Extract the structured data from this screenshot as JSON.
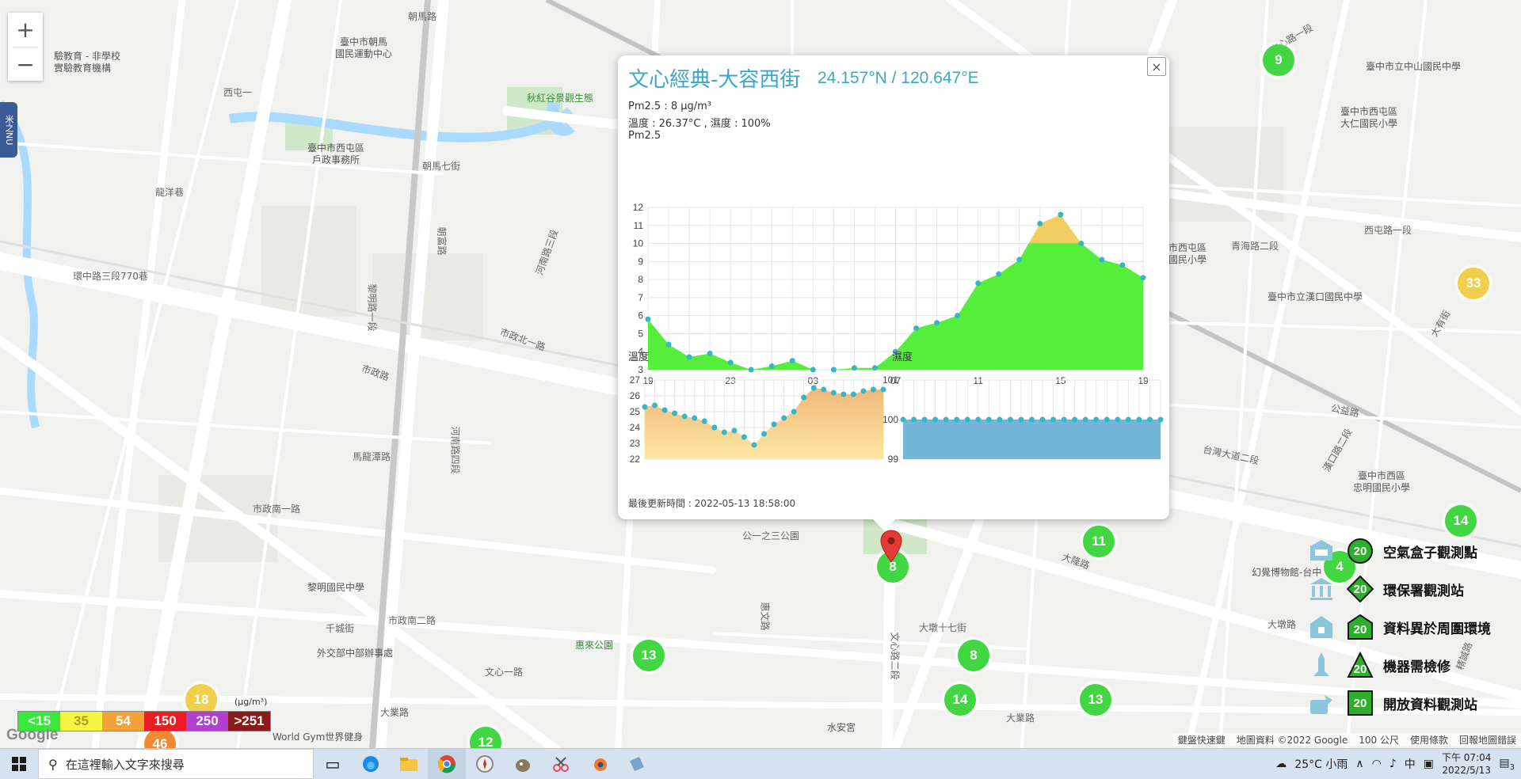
{
  "map": {
    "zoom_in": "+",
    "zoom_out": "−",
    "side_tab": "米之NU",
    "road_labels": [
      {
        "text": "朝馬路"
      },
      {
        "text": "西屯一"
      },
      {
        "text": "龍洋巷"
      },
      {
        "text": "環中路三段770巷"
      },
      {
        "text": "黎明路一段"
      },
      {
        "text": "市政路"
      },
      {
        "text": "市政北一路"
      },
      {
        "text": "河南路四段"
      },
      {
        "text": "馬龍潭路"
      },
      {
        "text": "市政南一路"
      },
      {
        "text": "市政南二路"
      },
      {
        "text": "千城街"
      },
      {
        "text": "文心一路"
      },
      {
        "text": "大業路"
      },
      {
        "text": "惠文路"
      },
      {
        "text": "大墩十七街"
      },
      {
        "text": "台灣大道二段"
      },
      {
        "text": "文心路二段"
      },
      {
        "text": "公益路"
      },
      {
        "text": "大隆路"
      },
      {
        "text": "西屯路一段"
      },
      {
        "text": "漢口路二段"
      },
      {
        "text": "青海路二段"
      },
      {
        "text": "大有街"
      },
      {
        "text": "文心路一段"
      },
      {
        "text": "大墩路"
      },
      {
        "text": "精誠路"
      },
      {
        "text": "朝馬七街"
      },
      {
        "text": "朝富路"
      },
      {
        "text": "河南路三段"
      },
      {
        "text": "公一之三公園"
      },
      {
        "text": "大業路"
      }
    ],
    "pois": [
      {
        "text": "臺中市朝馬\n國民運動中心",
        "kind": "poi"
      },
      {
        "text": "秋紅谷景觀生態",
        "kind": "park"
      },
      {
        "text": "臺中市西屯區\n戶政事務所",
        "kind": "poi"
      },
      {
        "text": "臺中市立中山國民中學",
        "kind": "poi"
      },
      {
        "text": "臺中市西屯區\n大仁國民小學",
        "kind": "poi"
      },
      {
        "text": "臺中市立漢口國民中學",
        "kind": "poi"
      },
      {
        "text": "市西屯區\n國民小學",
        "kind": "poi"
      },
      {
        "text": "臺中市西區\n忠明國民小學",
        "kind": "poi"
      },
      {
        "text": "幻覺博物館-台中",
        "kind": "poi"
      },
      {
        "text": "黎明國民中學",
        "kind": "poi"
      },
      {
        "text": "惠來公園",
        "kind": "park"
      },
      {
        "text": "外交部中部辦事處",
        "kind": "poi"
      },
      {
        "text": "World Gym世界健身",
        "kind": "poi"
      },
      {
        "text": "水安宮",
        "kind": "poi"
      },
      {
        "text": "驗教育 - 非學校\n實驗教育機構",
        "kind": "poi"
      }
    ],
    "clusters": [
      {
        "value": "9",
        "color": "green"
      },
      {
        "value": "33",
        "color": "yellow"
      },
      {
        "value": "14",
        "color": "green"
      },
      {
        "value": "11",
        "color": "green"
      },
      {
        "value": "4",
        "color": "green"
      },
      {
        "value": "8",
        "color": "green"
      },
      {
        "value": "13",
        "color": "green"
      },
      {
        "value": "8",
        "color": "green"
      },
      {
        "value": "14",
        "color": "green"
      },
      {
        "value": "13",
        "color": "green"
      },
      {
        "value": "18",
        "color": "yellow"
      },
      {
        "value": "46",
        "color": "orange"
      },
      {
        "value": "12",
        "color": "green"
      }
    ],
    "google_logo": "Google",
    "attribution": [
      "鍵盤快速鍵",
      "地圖資料 ©2022 Google",
      "100 公尺",
      "使用條款",
      "回報地圖錯誤"
    ]
  },
  "popup": {
    "close": "×",
    "title": "文心經典-大容西街",
    "coord": "24.157°N / 120.647°E",
    "pm_line": "Pm2.5 : 8 μg/m³",
    "temp_line": "溫度 : 26.37°C , 濕度 : 100%",
    "chart_pm_title": "Pm2.5",
    "chart_temp_title": "溫度",
    "chart_hum_title": "濕度",
    "updated": "最後更新時間 : 2022-05-13 18:58:00"
  },
  "chart_data": [
    {
      "type": "area",
      "title": "Pm2.5",
      "x_ticks": [
        "19",
        "23",
        "03",
        "07",
        "11",
        "15",
        "19"
      ],
      "ylim": [
        3,
        12
      ],
      "y_ticks": [
        3,
        4,
        5,
        6,
        7,
        8,
        9,
        10,
        11,
        12
      ],
      "values": [
        5.8,
        4.4,
        3.7,
        3.9,
        3.4,
        3.0,
        3.2,
        3.5,
        3.0,
        3.0,
        3.1,
        3.1,
        4.0,
        5.3,
        5.6,
        6.0,
        7.8,
        8.3,
        9.1,
        11.1,
        11.6,
        10.0,
        9.1,
        8.8,
        8.1
      ],
      "fill_colors": {
        "below": "#55ef3b",
        "above": "#f2cd62"
      },
      "threshold": 10
    },
    {
      "type": "area",
      "title": "溫度",
      "ylim": [
        22,
        27
      ],
      "y_ticks": [
        22,
        23,
        24,
        25,
        26,
        27
      ],
      "values": [
        25.3,
        25.4,
        25.1,
        24.9,
        24.7,
        24.6,
        24.4,
        24.0,
        23.7,
        23.8,
        23.4,
        22.9,
        23.6,
        24.2,
        24.6,
        25.0,
        25.9,
        26.5,
        26.4,
        26.2,
        26.1,
        26.1,
        26.3,
        26.4,
        26.4
      ]
    },
    {
      "type": "area",
      "title": "濕度",
      "ylim": [
        99,
        101
      ],
      "y_ticks": [
        99,
        100,
        101
      ],
      "values": [
        100,
        100,
        100,
        100,
        100,
        100,
        100,
        100,
        100,
        100,
        100,
        100,
        100,
        100,
        100,
        100,
        100,
        100,
        100,
        100,
        100,
        100,
        100,
        100,
        100
      ]
    }
  ],
  "legend": [
    {
      "label": "空氣盒子觀測點",
      "marker": "20",
      "shape": "circle",
      "icon": "airbox-icon"
    },
    {
      "label": "環保署觀測站",
      "marker": "20",
      "shape": "diamond",
      "icon": "epa-station-icon"
    },
    {
      "label": "資料異於周圍環境",
      "marker": "20",
      "shape": "house",
      "icon": "anomaly-icon"
    },
    {
      "label": "機器需檢修",
      "marker": "20",
      "shape": "triangle",
      "icon": "repair-icon"
    },
    {
      "label": "開放資料觀測站",
      "marker": "20",
      "shape": "square",
      "icon": "open-data-icon"
    }
  ],
  "scale": {
    "items": [
      {
        "text": "<15",
        "bg": "#38e83d",
        "fg": "#ffffff"
      },
      {
        "text": "35",
        "bg": "#f4f442",
        "fg": "#b59a2a"
      },
      {
        "text": "54",
        "bg": "#f3a23a",
        "fg": "#ffffff"
      },
      {
        "text": "150",
        "bg": "#ea1c24",
        "fg": "#ffffff"
      },
      {
        "text": "250",
        "bg": "#b23fce",
        "fg": "#ffffff"
      },
      {
        "text": ">251",
        "bg": "#8b1a1a",
        "fg": "#ffffff"
      }
    ],
    "unit": "(μg/m³)"
  },
  "taskbar": {
    "search_placeholder": "在這裡輸入文字來搜尋",
    "weather": "25°C 小雨",
    "ime": "中",
    "time": "下午 07:04",
    "date": "2022/5/13",
    "notifications": "3"
  }
}
